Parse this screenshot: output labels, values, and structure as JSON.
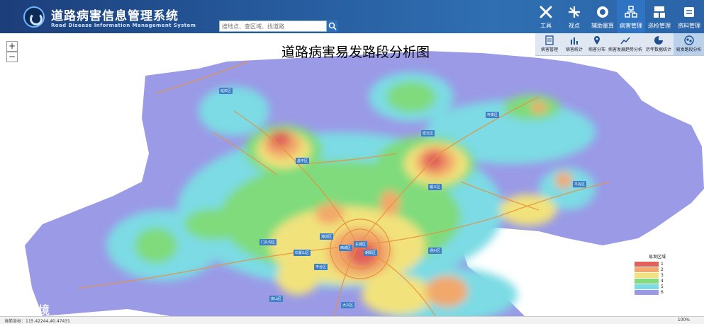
{
  "header": {
    "title": "道路病害信息管理系统",
    "subtitle": "Road Disease Information Management System",
    "search_placeholder": "搜地点、查区域、找道路"
  },
  "toolbar": [
    {
      "label": "工具",
      "icon": "tools-icon",
      "active": false
    },
    {
      "label": "视点",
      "icon": "viewpoint-icon",
      "active": false
    },
    {
      "label": "辅助量算",
      "icon": "measure-icon",
      "active": false
    },
    {
      "label": "病害管理",
      "icon": "disease-manage-icon",
      "active": true
    },
    {
      "label": "巡检管理",
      "icon": "inspection-icon",
      "active": false
    },
    {
      "label": "资料管理",
      "icon": "document-icon",
      "active": false
    }
  ],
  "submenu": [
    {
      "label": "病害管理",
      "icon": "list-icon",
      "active": false
    },
    {
      "label": "病害统计",
      "icon": "bar-chart-icon",
      "active": false
    },
    {
      "label": "病害分布",
      "icon": "location-pin-icon",
      "active": false
    },
    {
      "label": "病害发展趋势分析",
      "icon": "trend-icon",
      "active": false
    },
    {
      "label": "历年数据统计",
      "icon": "pie-chart-icon",
      "active": false
    },
    {
      "label": "易发路段分析",
      "icon": "cluster-icon",
      "active": true
    }
  ],
  "map": {
    "title": "道路病害易发路段分析图",
    "zoom_in": "+",
    "zoom_out": "−",
    "district_labels": [
      "延庆区",
      "怀柔区",
      "昌平区",
      "密云区",
      "顺义区",
      "平谷区",
      "海淀区",
      "门头沟区",
      "石景山区",
      "西城区",
      "东城区",
      "朝阳区",
      "丰台区",
      "通州区",
      "大兴区",
      "房山区"
    ]
  },
  "legend": {
    "title": "易发区域",
    "items": [
      {
        "label": "1",
        "color": "#e0605a"
      },
      {
        "label": "2",
        "color": "#f2a86a"
      },
      {
        "label": "3",
        "color": "#f1e27c"
      },
      {
        "label": "4",
        "color": "#7fdb7c"
      },
      {
        "label": "5",
        "color": "#7bdbe4"
      },
      {
        "label": "6",
        "color": "#9a9ae6"
      }
    ]
  },
  "status": {
    "coords": "当前坐标：115.42244,40.47431",
    "zoom": "100%"
  },
  "watermark": "大数跨境"
}
